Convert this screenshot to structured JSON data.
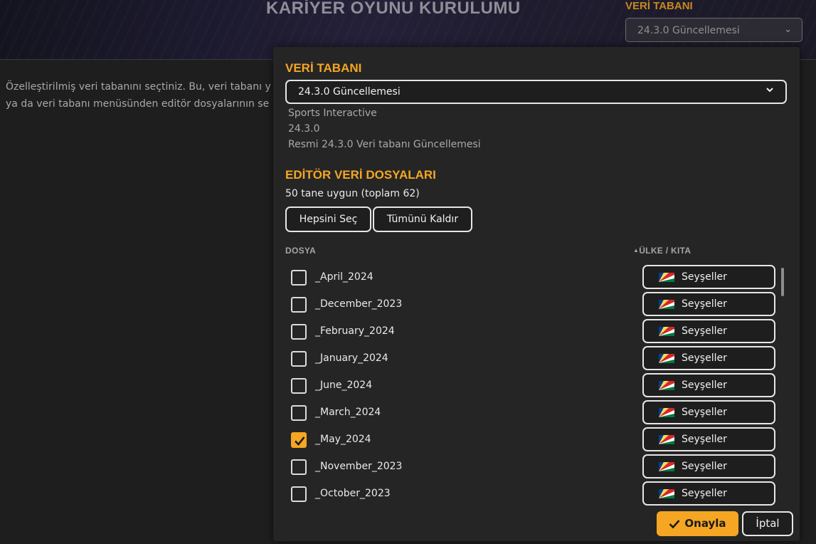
{
  "background": {
    "title": "KARİYER OYUNU KURULUMU",
    "db_label": "VERİ TABANI",
    "db_selected": "24.3.0 Güncellemesi",
    "description_line1": "Özelleştirilmiş veri tabanını seçtiniz. Bu, veri tabanı y",
    "description_line2": "ya da veri tabanı menüsünden editör dosyalarının se"
  },
  "modal": {
    "db_heading": "VERİ TABANI",
    "db_selected": "24.3.0 Güncellemesi",
    "db_publisher": "Sports Interactive",
    "db_version": "24.3.0",
    "db_description": "Resmi 24.3.0 Veri tabanı Güncellemesi",
    "editor_heading": "EDİTÖR VERİ DOSYALARI",
    "available_count": "50 tane uygun (toplam 62)",
    "select_all_label": "Hepsini Seç",
    "clear_all_label": "Tümünü Kaldır",
    "col_file": "DOSYA",
    "col_country": "ÜLKE / KITA",
    "sort_indicator": "▲",
    "files": [
      {
        "name": "_April_2024",
        "country": "Seyşeller",
        "checked": false
      },
      {
        "name": "_December_2023",
        "country": "Seyşeller",
        "checked": false
      },
      {
        "name": "_February_2024",
        "country": "Seyşeller",
        "checked": false
      },
      {
        "name": "_January_2024",
        "country": "Seyşeller",
        "checked": false
      },
      {
        "name": "_June_2024",
        "country": "Seyşeller",
        "checked": false
      },
      {
        "name": "_March_2024",
        "country": "Seyşeller",
        "checked": false
      },
      {
        "name": "_May_2024",
        "country": "Seyşeller",
        "checked": true
      },
      {
        "name": "_November_2023",
        "country": "Seyşeller",
        "checked": false
      },
      {
        "name": "_October_2023",
        "country": "Seyşeller",
        "checked": false
      }
    ],
    "confirm_label": "Onayla",
    "cancel_label": "İptal"
  },
  "colors": {
    "accent": "#f5a623",
    "panel": "#252525",
    "background": "#1e1e1e"
  }
}
